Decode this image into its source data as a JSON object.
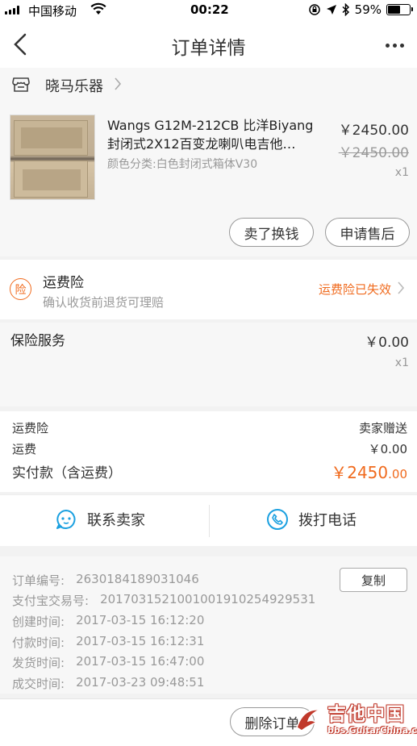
{
  "status_bar": {
    "carrier": "中国移动",
    "time": "00:22",
    "battery": "59%",
    "battery_level": 0.59
  },
  "nav": {
    "title": "订单详情"
  },
  "shop": {
    "name": "晓马乐器"
  },
  "product": {
    "title_line1": "Wangs G12M-212CB 比洋Biyang",
    "title_line2": "封闭式2X12百变龙喇叭电吉他…",
    "spec": "颜色分类:白色封闭式箱体V30",
    "price": "￥2450.00",
    "original_price": "￥2450.00",
    "quantity": "x1",
    "sell_button": "卖了换钱",
    "after_sale_button": "申请售后"
  },
  "freight_insurance": {
    "icon_char": "险",
    "title": "运费险",
    "subtitle": "确认收货前退货可理赔",
    "status": "运费险已失效"
  },
  "insurance_service": {
    "title": "保险服务",
    "price": "￥0.00",
    "quantity": "x1"
  },
  "summary": {
    "freight_ins_label": "运费险",
    "freight_ins_value": "卖家赠送",
    "shipping_label": "运费",
    "shipping_value": "￥0.00",
    "paid_label": "实付款（含运费）",
    "paid_main": "￥2450",
    "paid_decimal": ".00"
  },
  "contact": {
    "seller_label": "联系卖家",
    "call_label": "拨打电话"
  },
  "order_info": {
    "copy_button": "复制",
    "rows": [
      {
        "label": "订单编号:",
        "value": "2630184189031046"
      },
      {
        "label": "支付宝交易号:",
        "value": "2017031521001001910254929531"
      },
      {
        "label": "创建时间:",
        "value": "2017-03-15 16:12:20"
      },
      {
        "label": "付款时间:",
        "value": "2017-03-15 16:12:31"
      },
      {
        "label": "发货时间:",
        "value": "2017-03-15 16:47:00"
      },
      {
        "label": "成交时间:",
        "value": "2017-03-23 09:48:51"
      }
    ]
  },
  "bottom": {
    "delete_button": "删除订单"
  },
  "watermark": {
    "text": "吉他中国",
    "url": "bbs.GuitarChina.com"
  },
  "colors": {
    "accent": "#f06a1d",
    "contact_icon": "#1aa0e0"
  },
  "icons": [
    "signal-icon",
    "wifi-icon",
    "lock-rotation-icon",
    "location-icon",
    "bluetooth-icon",
    "battery-icon",
    "back-arrow-icon",
    "more-icon",
    "shop-icon",
    "chevron-right-icon",
    "insurance-icon",
    "chat-icon",
    "phone-icon"
  ]
}
